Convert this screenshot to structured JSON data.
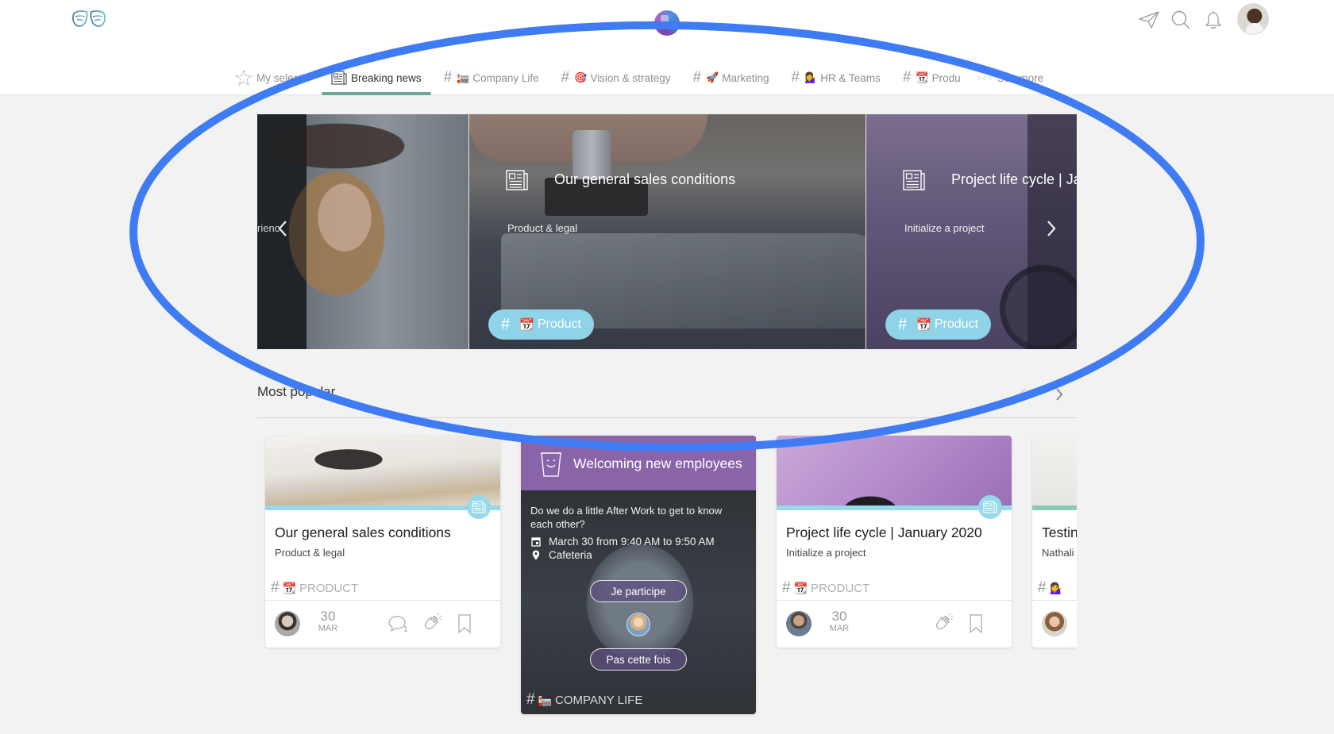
{
  "header": {
    "logo_icon": "wings-logo-icon",
    "center_avatar_icon": "workspace-avatar",
    "icons": [
      "send-icon",
      "search-icon",
      "bell-icon"
    ],
    "user_avatar": "user-avatar"
  },
  "tabs": [
    {
      "label": "My selecti",
      "icon": "star-icon",
      "hash": false,
      "active": false
    },
    {
      "label": "Breaking news",
      "icon": "newspaper-icon",
      "hash": false,
      "active": true
    },
    {
      "label": "Company Life",
      "emoji": "🏣",
      "hash": true,
      "active": false
    },
    {
      "label": "Vision & strategy",
      "emoji": "🎯",
      "hash": true,
      "active": false
    },
    {
      "label": "Marketing",
      "emoji": "🚀",
      "hash": true,
      "active": false
    },
    {
      "label": "HR & Teams",
      "emoji": "💁‍♀️",
      "hash": true,
      "active": false
    },
    {
      "label": "Produ",
      "emoji": "📆",
      "hash": true,
      "active": false
    },
    {
      "label": "See more",
      "icon": "dots-icon",
      "hash": false,
      "active": false
    }
  ],
  "hash_symbol": "#",
  "dots": "○○○",
  "carousel": {
    "prev_partial_text": "rienc",
    "slides": [
      {
        "title": "Our general sales conditions",
        "subtitle": "Product & legal",
        "tag_emoji": "📆",
        "tag_label": "Product"
      },
      {
        "title": "Project life cycle | Ja",
        "subtitle": "Initialize a project",
        "tag_emoji": "📆",
        "tag_label": "Product"
      }
    ]
  },
  "most_popular": {
    "title": "Most popular",
    "cards": [
      {
        "title": "Our general sales conditions",
        "subtitle": "Product & legal",
        "tag_emoji": "📆",
        "tag_label": "PRODUCT",
        "date_day": "30",
        "date_month": "MAR",
        "comment_count": "1"
      },
      {
        "title": "Project life cycle | January 2020",
        "subtitle": "Initialize a project",
        "tag_emoji": "📆",
        "tag_label": "PRODUCT",
        "date_day": "30",
        "date_month": "MAR"
      },
      {
        "title": "Testin",
        "subtitle": "Nathali",
        "tag_emoji": "💁‍♀️",
        "tag_label": ""
      }
    ],
    "event": {
      "title": "Welcoming new employees",
      "description": "Do we do a little After Work to get to know each other?",
      "when": "March 30 from 9:40 AM to 9:50 AM",
      "where": "Cafeteria",
      "accept_label": "Je participe",
      "decline_label": "Pas cette fois",
      "tag_emoji": "🏣",
      "tag_label": "COMPANY LIFE"
    }
  },
  "colors": {
    "accent_tab": "#6aa89a",
    "tag_blue": "#8fd3e9",
    "event_purple": "#8a64a9",
    "annotation_blue": "#3f7cf4"
  }
}
